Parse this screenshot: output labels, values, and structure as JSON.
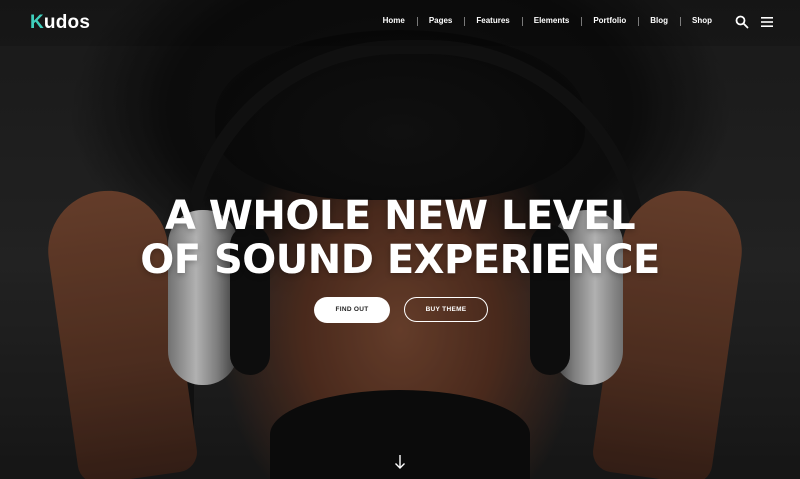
{
  "brand": {
    "logo_first": "K",
    "logo_rest": "udos",
    "accent": "#3fd0bd"
  },
  "nav": {
    "items": [
      "Home",
      "Pages",
      "Features",
      "Elements",
      "Portfolio",
      "Blog",
      "Shop"
    ]
  },
  "icons": {
    "search": "search-icon",
    "menu": "hamburger-menu-icon",
    "scroll": "arrow-down-icon"
  },
  "hero": {
    "headline_line1": "A WHOLE NEW LEVEL",
    "headline_line2": "OF SOUND EXPERIENCE",
    "primary_button": "FIND OUT",
    "secondary_button": "BUY THEME"
  }
}
